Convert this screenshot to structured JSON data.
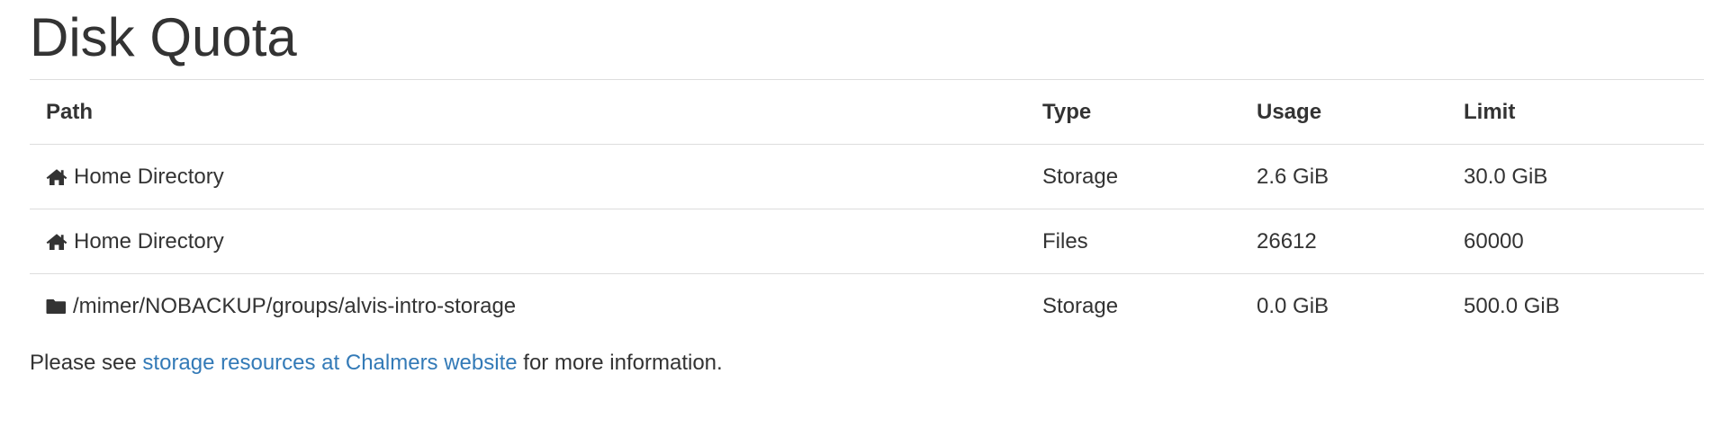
{
  "page": {
    "title": "Disk Quota"
  },
  "table": {
    "headers": {
      "path": "Path",
      "type": "Type",
      "usage": "Usage",
      "limit": "Limit"
    },
    "rows": [
      {
        "icon": "home-icon",
        "path": "Home Directory",
        "type": "Storage",
        "usage": "2.6 GiB",
        "limit": "30.0 GiB"
      },
      {
        "icon": "home-icon",
        "path": "Home Directory",
        "type": "Files",
        "usage": "26612",
        "limit": "60000"
      },
      {
        "icon": "folder-icon",
        "path": "/mimer/NOBACKUP/groups/alvis-intro-storage",
        "type": "Storage",
        "usage": "0.0 GiB",
        "limit": "500.0 GiB"
      }
    ]
  },
  "footer": {
    "prefix": "Please see ",
    "link_text": "storage resources at Chalmers website",
    "suffix": " for more information."
  },
  "colors": {
    "text": "#333333",
    "link": "#337ab7",
    "border": "#dddddd"
  }
}
